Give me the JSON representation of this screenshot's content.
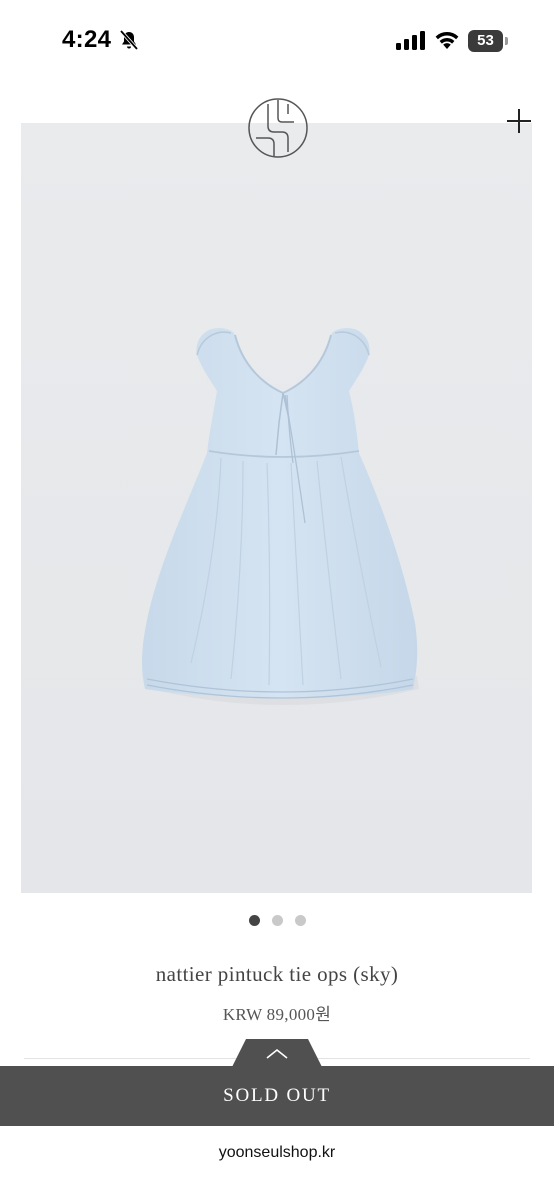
{
  "status_bar": {
    "time": "4:24",
    "battery": "53",
    "icons": [
      "bell-slash-icon",
      "cellular-signal-icon",
      "wifi-icon",
      "battery-icon"
    ]
  },
  "header": {
    "logo": "brand-logo",
    "menu_icon": "plus-icon"
  },
  "gallery": {
    "image": "light blue sleeveless dress",
    "dot_count": 3,
    "active_index": 0
  },
  "product": {
    "name": "nattier pintuck tie ops (sky)",
    "price": "KRW 89,000원"
  },
  "purchase_bar": {
    "toggle_icon": "chevron-up-icon",
    "label": "SOLD OUT"
  },
  "browser": {
    "url": "yoonseulshop.kr"
  },
  "colors": {
    "bar_background": "#505050",
    "image_background": "#e8eaec",
    "dress": "#cfdfee",
    "dot_active": "#444444",
    "dot_inactive": "#c9c9c9"
  }
}
